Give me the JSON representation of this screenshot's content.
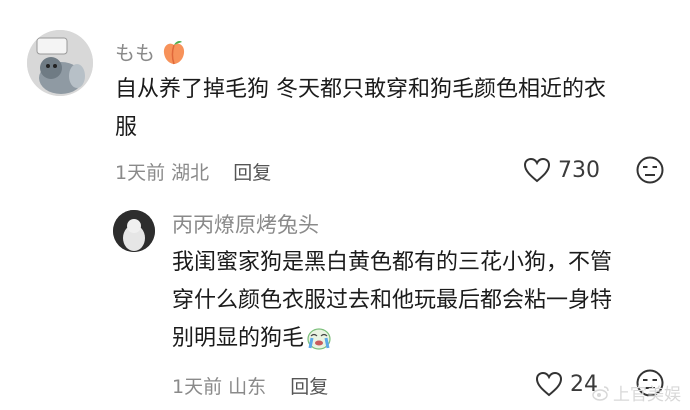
{
  "comment": {
    "username": "もも",
    "text_lines": [
      "自从养了掉毛狗 冬天都只敢穿和狗毛颜色相近的衣",
      "服"
    ],
    "time": "1天前",
    "location": "湖北",
    "reply_label": "回复",
    "likes": "730"
  },
  "reply": {
    "username": "丙丙燎原烤兔头",
    "text_lines": [
      "我闺蜜家狗是黑白黄色都有的三花小狗，不管",
      "穿什么颜色衣服过去和他玩最后都会粘一身特",
      "别明显的狗毛"
    ],
    "time": "1天前",
    "location": "山东",
    "reply_label": "回复",
    "likes": "24"
  },
  "watermark": "上官美娱",
  "icons": {
    "username_emoji": "peach-emoji",
    "reply_emoji": "crying-face-emoji",
    "like": "heart-outline-icon",
    "dislike": "unamused-face-icon"
  },
  "colors": {
    "username": "#8a8a8a",
    "body_text": "#1b1b1b",
    "meta": "#8a8a8a"
  }
}
